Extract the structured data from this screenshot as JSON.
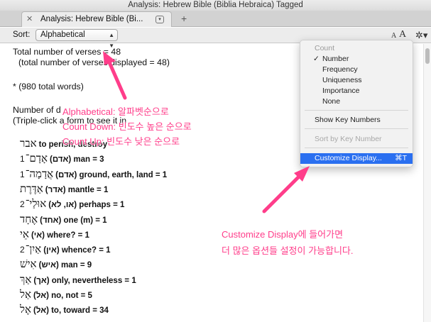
{
  "window": {
    "title": "Analysis: Hebrew Bible (Biblia Hebraica) Tagged"
  },
  "tab": {
    "close_glyph": "✕",
    "title": "Analysis: Hebrew Bible (Bi...",
    "menu_glyph": "▾",
    "add_glyph": "+"
  },
  "toolbar": {
    "sort_label": "Sort:",
    "sort_value": "Alphabetical",
    "font_small": "A",
    "font_large": "A",
    "gear_glyph": "✲▾"
  },
  "content": {
    "total_verses": "Total number of verses = 48",
    "verses_displayed": "(total number of verses displayed = 48)",
    "total_words": "* (980 total words)",
    "number_of_forms": "Number of d",
    "triple_click": "(Triple-click a form to see it in",
    "entries": [
      {
        "prefix": "",
        "hebrew": "אבר",
        "gloss": "to perish, destroy"
      },
      {
        "prefix": "1",
        "hebrew": "אָדָם־",
        "gloss": "(אדם) man = 3"
      },
      {
        "prefix": "1",
        "hebrew": "אֲדָמָה־",
        "gloss": "(אדם) ground, earth, land = 1"
      },
      {
        "prefix": "",
        "hebrew": "אַדֶּרֶת",
        "gloss": "(אדר) mantle = 1"
      },
      {
        "prefix": "2",
        "hebrew": "אוּלַי־",
        "gloss": "(או, לא) perhaps = 1"
      },
      {
        "prefix": "",
        "hebrew": "אֶחָד",
        "gloss": "(אחד) one (m) = 1"
      },
      {
        "prefix": "",
        "hebrew": "אֵי",
        "gloss": "(אי) where? = 1"
      },
      {
        "prefix": "2",
        "hebrew": "אַיִן־",
        "gloss": "(אין) whence? = 1"
      },
      {
        "prefix": "",
        "hebrew": "אִישׁ",
        "gloss": "(איש) man = 9"
      },
      {
        "prefix": "",
        "hebrew": "אַךְ",
        "gloss": "(אך) only, nevertheless = 1"
      },
      {
        "prefix": "",
        "hebrew": "אַל",
        "gloss": "(אל) no, not = 5"
      },
      {
        "prefix": "",
        "hebrew": "אֶל",
        "gloss": "(אל) to, toward = 34"
      }
    ]
  },
  "menu": {
    "header_count": "Count",
    "check_glyph": "✓",
    "items": [
      "Number",
      "Frequency",
      "Uniqueness",
      "Importance",
      "None"
    ],
    "show_key_numbers": "Show Key Numbers",
    "sort_by_key_number": "Sort by Key Number",
    "customize_display": "Customize Display...",
    "customize_shortcut": "⌘T"
  },
  "annotations": {
    "line1": "Alphabetical: 알파벳순으로",
    "line2": "Count Down: 빈도수 높은 순으로",
    "line3": "Count Up: 빈도수 낮은 순으로",
    "note1": "Customize Display에 들어가면",
    "note2": "더 많은 옵션들 설정이 가능합니다.",
    "color": "#ff3d8a"
  }
}
